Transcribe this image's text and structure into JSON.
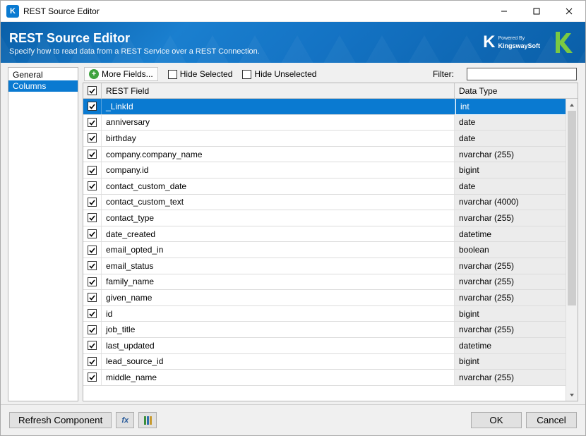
{
  "window": {
    "title": "REST Source Editor"
  },
  "header": {
    "title": "REST Source Editor",
    "subtitle": "Specify how to read data from a REST Service over a REST Connection.",
    "powered_by": "Powered By",
    "brand": "KingswaySoft"
  },
  "sidebar": {
    "items": [
      {
        "label": "General",
        "selected": false
      },
      {
        "label": "Columns",
        "selected": true
      }
    ]
  },
  "toolbar": {
    "more_fields": "More Fields...",
    "hide_selected": "Hide Selected",
    "hide_unselected": "Hide Unselected",
    "filter_label": "Filter:",
    "filter_value": ""
  },
  "grid": {
    "header": {
      "field": "REST Field",
      "type": "Data Type"
    },
    "rows": [
      {
        "field": "_LinkId",
        "type": "int",
        "selected": true,
        "checked": true
      },
      {
        "field": "anniversary",
        "type": "date",
        "checked": true
      },
      {
        "field": "birthday",
        "type": "date",
        "checked": true
      },
      {
        "field": "company.company_name",
        "type": "nvarchar (255)",
        "checked": true
      },
      {
        "field": "company.id",
        "type": "bigint",
        "checked": true
      },
      {
        "field": "contact_custom_date",
        "type": "date",
        "checked": true
      },
      {
        "field": "contact_custom_text",
        "type": "nvarchar (4000)",
        "checked": true
      },
      {
        "field": "contact_type",
        "type": "nvarchar (255)",
        "checked": true
      },
      {
        "field": "date_created",
        "type": "datetime",
        "checked": true
      },
      {
        "field": "email_opted_in",
        "type": "boolean",
        "checked": true
      },
      {
        "field": "email_status",
        "type": "nvarchar (255)",
        "checked": true
      },
      {
        "field": "family_name",
        "type": "nvarchar (255)",
        "checked": true
      },
      {
        "field": "given_name",
        "type": "nvarchar (255)",
        "checked": true
      },
      {
        "field": "id",
        "type": "bigint",
        "checked": true
      },
      {
        "field": "job_title",
        "type": "nvarchar (255)",
        "checked": true
      },
      {
        "field": "last_updated",
        "type": "datetime",
        "checked": true
      },
      {
        "field": "lead_source_id",
        "type": "bigint",
        "checked": true
      },
      {
        "field": "middle_name",
        "type": "nvarchar (255)",
        "checked": true
      }
    ]
  },
  "footer": {
    "refresh": "Refresh Component",
    "ok": "OK",
    "cancel": "Cancel"
  }
}
